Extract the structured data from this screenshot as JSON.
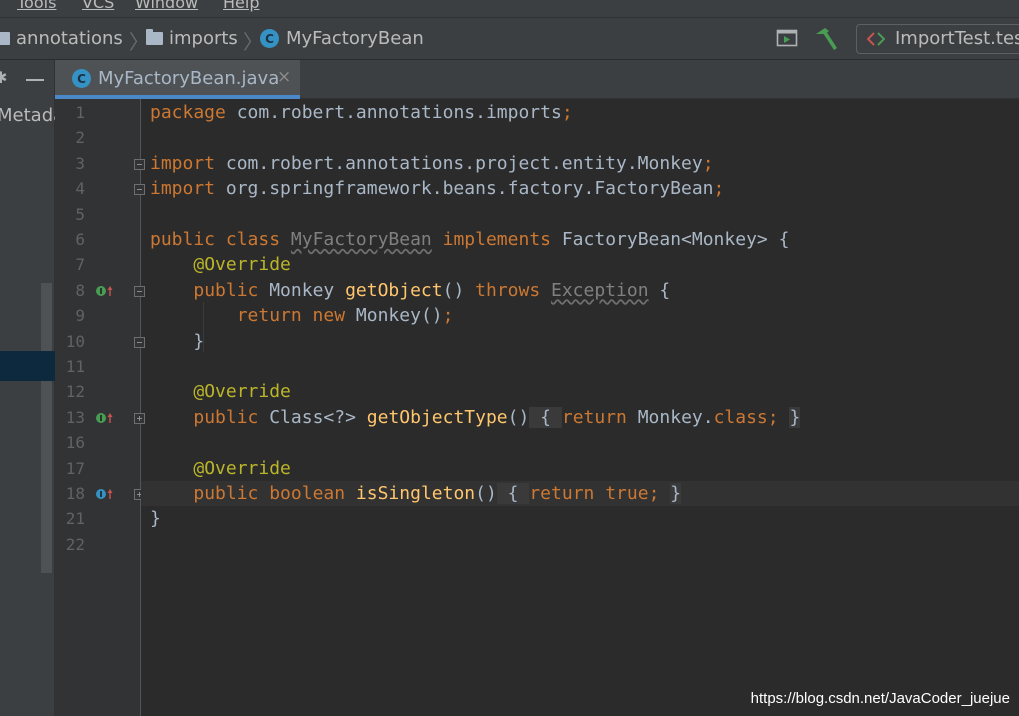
{
  "menu": {
    "items": [
      "Tools",
      "VCS",
      "Window",
      "Help"
    ]
  },
  "breadcrumb": {
    "items": [
      "annotations",
      "imports",
      "MyFactoryBean"
    ]
  },
  "toolbar": {
    "run_config": "ImportTest.test"
  },
  "sidebar": {
    "partial_label": "Metada"
  },
  "tab": {
    "label": "MyFactoryBean.java",
    "close_glyph": "×",
    "icon_letter": "C"
  },
  "editor": {
    "line_numbers": [
      "1",
      "2",
      "3",
      "4",
      "5",
      "6",
      "7",
      "8",
      "9",
      "10",
      "11",
      "12",
      "13",
      "16",
      "17",
      "18",
      "21",
      "22"
    ],
    "lines": [
      {
        "tokens": [
          {
            "t": "package ",
            "c": "kw"
          },
          {
            "t": "com.robert.annotations.imports",
            "c": ""
          },
          {
            "t": ";",
            "c": "kw"
          }
        ]
      },
      {
        "tokens": []
      },
      {
        "tokens": [
          {
            "t": "import ",
            "c": "kw"
          },
          {
            "t": "com.robert.annotations.project.entity.Monkey",
            "c": ""
          },
          {
            "t": ";",
            "c": "kw"
          }
        ]
      },
      {
        "tokens": [
          {
            "t": "import ",
            "c": "kw"
          },
          {
            "t": "org.springframework.beans.factory.FactoryBean",
            "c": ""
          },
          {
            "t": ";",
            "c": "kw"
          }
        ]
      },
      {
        "tokens": []
      },
      {
        "tokens": [
          {
            "t": "public class ",
            "c": "kw"
          },
          {
            "t": "MyFactoryBean",
            "c": "unused"
          },
          {
            "t": " ",
            "c": ""
          },
          {
            "t": "implements ",
            "c": "kw"
          },
          {
            "t": "FactoryBean<Monkey> {",
            "c": ""
          }
        ]
      },
      {
        "tokens": [
          {
            "t": "    ",
            "c": ""
          },
          {
            "t": "@Override",
            "c": "ann"
          }
        ]
      },
      {
        "tokens": [
          {
            "t": "    ",
            "c": ""
          },
          {
            "t": "public ",
            "c": "kw"
          },
          {
            "t": "Monkey ",
            "c": ""
          },
          {
            "t": "getObject",
            "c": "fn"
          },
          {
            "t": "() ",
            "c": ""
          },
          {
            "t": "throws ",
            "c": "kw"
          },
          {
            "t": "Exception",
            "c": "unused"
          },
          {
            "t": " {",
            "c": ""
          }
        ]
      },
      {
        "tokens": [
          {
            "t": "        ",
            "c": ""
          },
          {
            "t": "return new ",
            "c": "kw"
          },
          {
            "t": "Monkey()",
            "c": ""
          },
          {
            "t": ";",
            "c": "kw"
          }
        ]
      },
      {
        "tokens": [
          {
            "t": "    }",
            "c": ""
          }
        ]
      },
      {
        "tokens": []
      },
      {
        "tokens": [
          {
            "t": "    ",
            "c": ""
          },
          {
            "t": "@Override",
            "c": "ann"
          }
        ]
      },
      {
        "tokens": [
          {
            "t": "    ",
            "c": ""
          },
          {
            "t": "public ",
            "c": "kw"
          },
          {
            "t": "Class<?> ",
            "c": ""
          },
          {
            "t": "getObjectType",
            "c": "fn"
          },
          {
            "t": "()",
            "c": ""
          },
          {
            "t": " { ",
            "c": "collapsed"
          },
          {
            "t": "return ",
            "c": "kw"
          },
          {
            "t": "Monkey.",
            "c": ""
          },
          {
            "t": "class",
            "c": "kw"
          },
          {
            "t": "; ",
            "c": "kw"
          },
          {
            "t": "}",
            "c": "collapsed"
          }
        ]
      },
      {
        "tokens": []
      },
      {
        "tokens": [
          {
            "t": "    ",
            "c": ""
          },
          {
            "t": "@Override",
            "c": "ann"
          }
        ]
      },
      {
        "tokens": [
          {
            "t": "    ",
            "c": ""
          },
          {
            "t": "public boolean ",
            "c": "kw"
          },
          {
            "t": "isSingleton",
            "c": "fn"
          },
          {
            "t": "()",
            "c": ""
          },
          {
            "t": " { ",
            "c": "collapsed"
          },
          {
            "t": "return true",
            "c": "kw"
          },
          {
            "t": "; ",
            "c": "kw"
          },
          {
            "t": "}",
            "c": "collapsed"
          }
        ]
      },
      {
        "tokens": [
          {
            "t": "}",
            "c": ""
          }
        ]
      },
      {
        "tokens": []
      }
    ],
    "current_line": "18",
    "implements_markers": [
      "8",
      "13",
      "18"
    ],
    "fold_markers": [
      {
        "line": "3",
        "type": "minus"
      },
      {
        "line": "4",
        "type": "minus"
      },
      {
        "line": "8",
        "type": "minus"
      },
      {
        "line": "10",
        "type": "minus"
      },
      {
        "line": "13",
        "type": "plus"
      },
      {
        "line": "18",
        "type": "plus"
      }
    ]
  },
  "watermark": "https://blog.csdn.net/JavaCoder_juejue",
  "colors": {
    "keyword": "#cc7832",
    "method": "#ffc66d",
    "annotation": "#bbb529",
    "text": "#a9b7c6",
    "accent": "#4a88c7",
    "editor_bg": "#2b2b2b"
  }
}
